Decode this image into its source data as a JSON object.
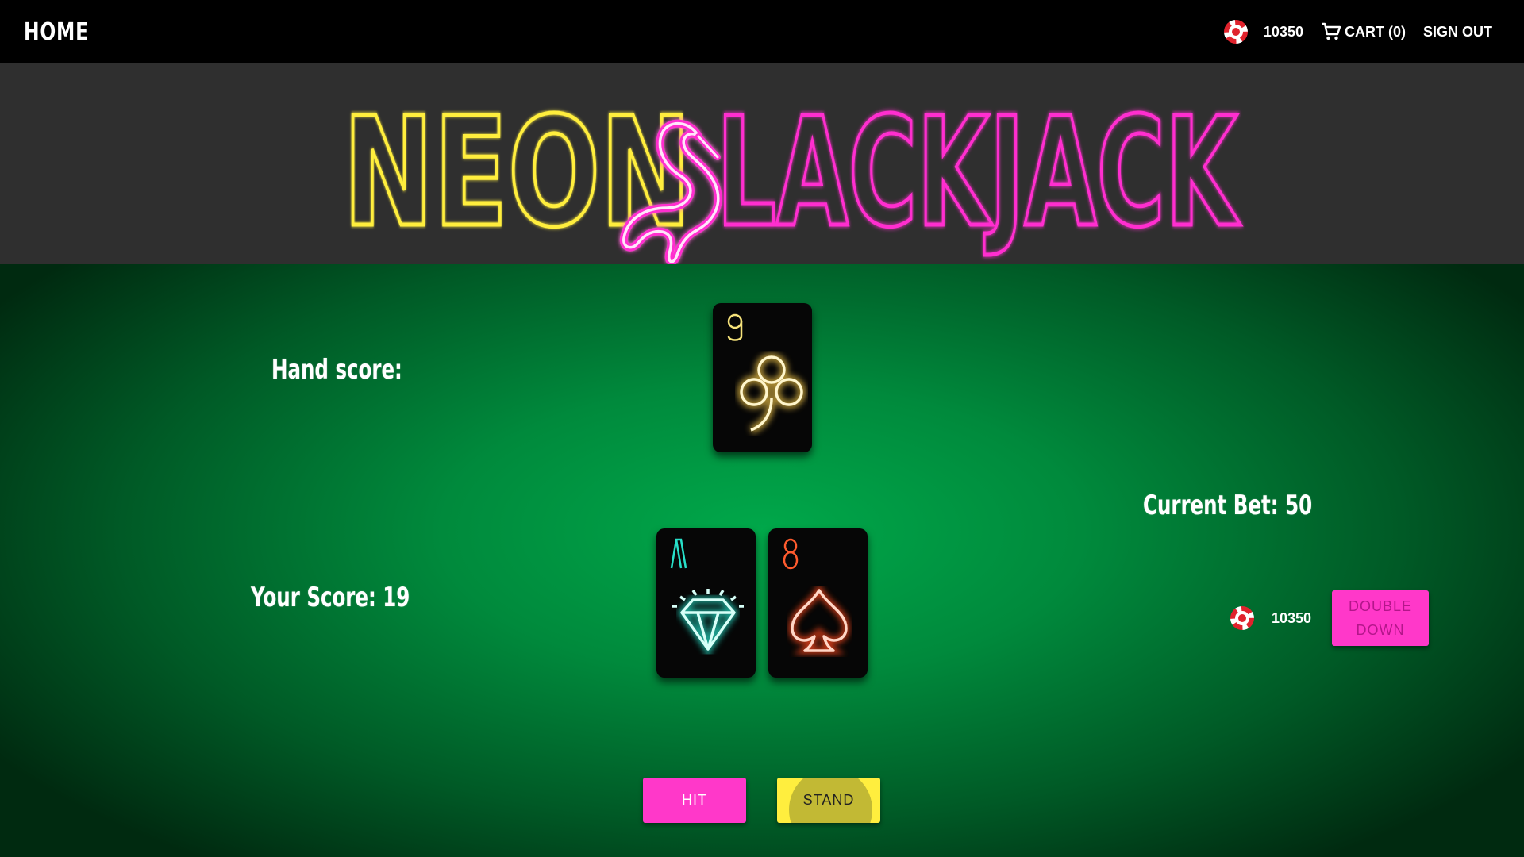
{
  "nav": {
    "home_label": "HOME",
    "balance": "10350",
    "cart_label": "CART (0)",
    "signout_label": "SIGN OUT"
  },
  "banner": {
    "logo_word1": "NEON",
    "logo_word2": "LACKJACK",
    "logo_icon": "flamingo-icon",
    "colors": {
      "neon_yellow": "#ffee3e",
      "neon_pink": "#ff2ecf",
      "flamingo_white": "#ffe6fa"
    }
  },
  "dealer": {
    "hand_score_label": "Hand score:",
    "cards": [
      {
        "rank": "9",
        "suit": "club",
        "color": "#f5e27a"
      }
    ]
  },
  "player": {
    "score_label": "Your Score: 19",
    "current_bet_label": "Current Bet: 50",
    "balance": "10350",
    "cards": [
      {
        "rank": "A",
        "suit": "diamond",
        "color": "#27e0c9"
      },
      {
        "rank": "8",
        "suit": "spade",
        "color": "#ff5b2e"
      }
    ]
  },
  "actions": {
    "double_down_label": "DOUBLE DOWN",
    "hit_label": "HIT",
    "stand_label": "STAND"
  },
  "theme": {
    "table_green": "#00a84a",
    "button_pink": "#ff38c9",
    "button_yellow": "#ffee3e"
  }
}
